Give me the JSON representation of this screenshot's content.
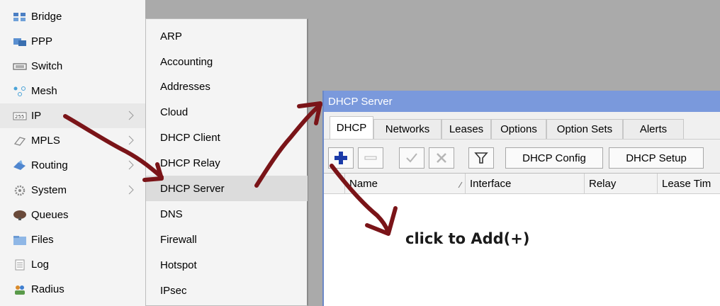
{
  "main_menu": {
    "items": [
      {
        "label": "Bridge",
        "icon": "bridge-icon"
      },
      {
        "label": "PPP",
        "icon": "ppp-icon"
      },
      {
        "label": "Switch",
        "icon": "switch-icon"
      },
      {
        "label": "Mesh",
        "icon": "mesh-icon"
      },
      {
        "label": "IP",
        "icon": "ip-icon",
        "has_submenu": true
      },
      {
        "label": "MPLS",
        "icon": "mpls-icon",
        "has_submenu": true
      },
      {
        "label": "Routing",
        "icon": "routing-icon",
        "has_submenu": true
      },
      {
        "label": "System",
        "icon": "gear-icon",
        "has_submenu": true
      },
      {
        "label": "Queues",
        "icon": "queues-icon"
      },
      {
        "label": "Files",
        "icon": "folder-icon"
      },
      {
        "label": "Log",
        "icon": "log-icon"
      },
      {
        "label": "Radius",
        "icon": "radius-icon"
      }
    ]
  },
  "ip_submenu": {
    "items": [
      "ARP",
      "Accounting",
      "Addresses",
      "Cloud",
      "DHCP Client",
      "DHCP Relay",
      "DHCP Server",
      "DNS",
      "Firewall",
      "Hotspot",
      "IPsec"
    ],
    "active": "DHCP Server"
  },
  "dhcp_window": {
    "title": "DHCP Server",
    "tabs": [
      "DHCP",
      "Networks",
      "Leases",
      "Options",
      "Option Sets",
      "Alerts"
    ],
    "active_tab": "DHCP",
    "toolbar": {
      "add_icon": "plus-icon",
      "remove_icon": "minus-icon",
      "enable_icon": "check-icon",
      "disable_icon": "cross-icon",
      "filter_icon": "filter-icon",
      "dhcp_config_label": "DHCP Config",
      "dhcp_setup_label": "DHCP Setup"
    },
    "columns": [
      "Name",
      "Interface",
      "Relay",
      "Lease Tim"
    ]
  },
  "annotation": {
    "text": "click to Add(+)"
  },
  "colors": {
    "titlebar": "#7a99dc",
    "arrow": "#7a1418",
    "workspace": "#aaaaaa"
  }
}
